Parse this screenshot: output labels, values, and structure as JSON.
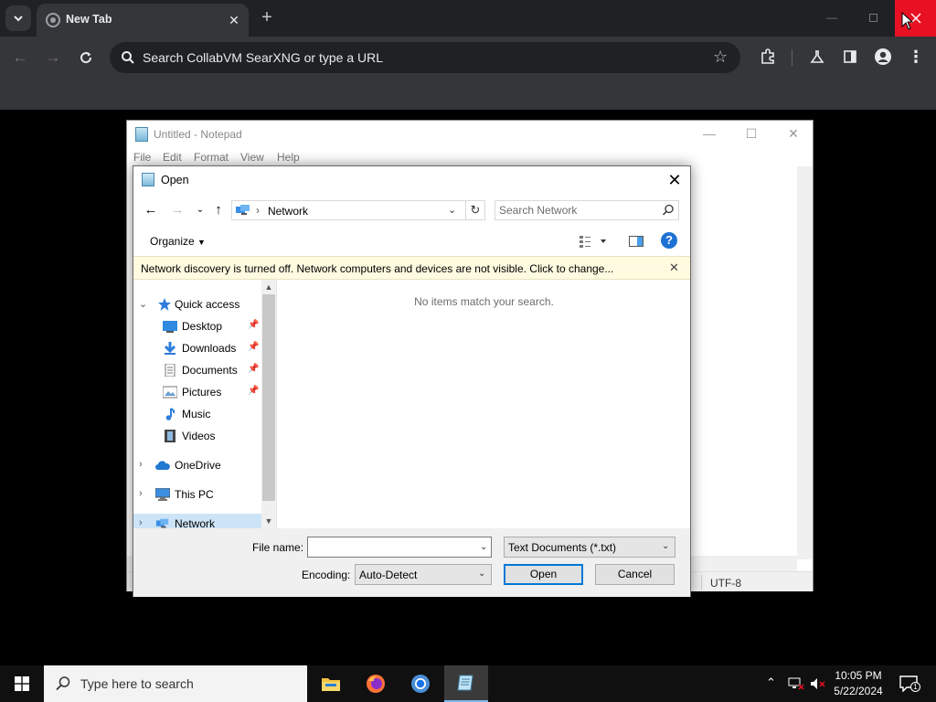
{
  "chrome": {
    "tab_title": "New Tab",
    "omnibox_placeholder": "Search CollabVM SearXNG or type a URL"
  },
  "notepad": {
    "title": "Untitled - Notepad",
    "menu": [
      "File",
      "Edit",
      "Format",
      "View",
      "Help"
    ],
    "status_encoding": "UTF-8"
  },
  "dialog": {
    "title": "Open",
    "address": "Network",
    "search_placeholder": "Search Network",
    "organize_label": "Organize",
    "infobar_text": "Network discovery is turned off. Network computers and devices are not visible. Click to change...",
    "empty_message": "No items match your search.",
    "nav": {
      "quick_access": "Quick access",
      "desktop": "Desktop",
      "downloads": "Downloads",
      "documents": "Documents",
      "pictures": "Pictures",
      "music": "Music",
      "videos": "Videos",
      "onedrive": "OneDrive",
      "this_pc": "This PC",
      "network": "Network"
    },
    "file_name_label": "File name:",
    "file_name_value": "",
    "file_type_value": "Text Documents (*.txt)",
    "encoding_label": "Encoding:",
    "encoding_value": "Auto-Detect",
    "open_label": "Open",
    "cancel_label": "Cancel"
  },
  "taskbar": {
    "search_placeholder": "Type here to search",
    "time": "10:05 PM",
    "date": "5/22/2024",
    "notification_count": "1"
  },
  "colors": {
    "chrome_dark": "#202124",
    "chrome_toolbar": "#35363a",
    "close_red": "#e81123",
    "accent_blue": "#0078d7",
    "infobar_yellow": "#fffbe0"
  }
}
